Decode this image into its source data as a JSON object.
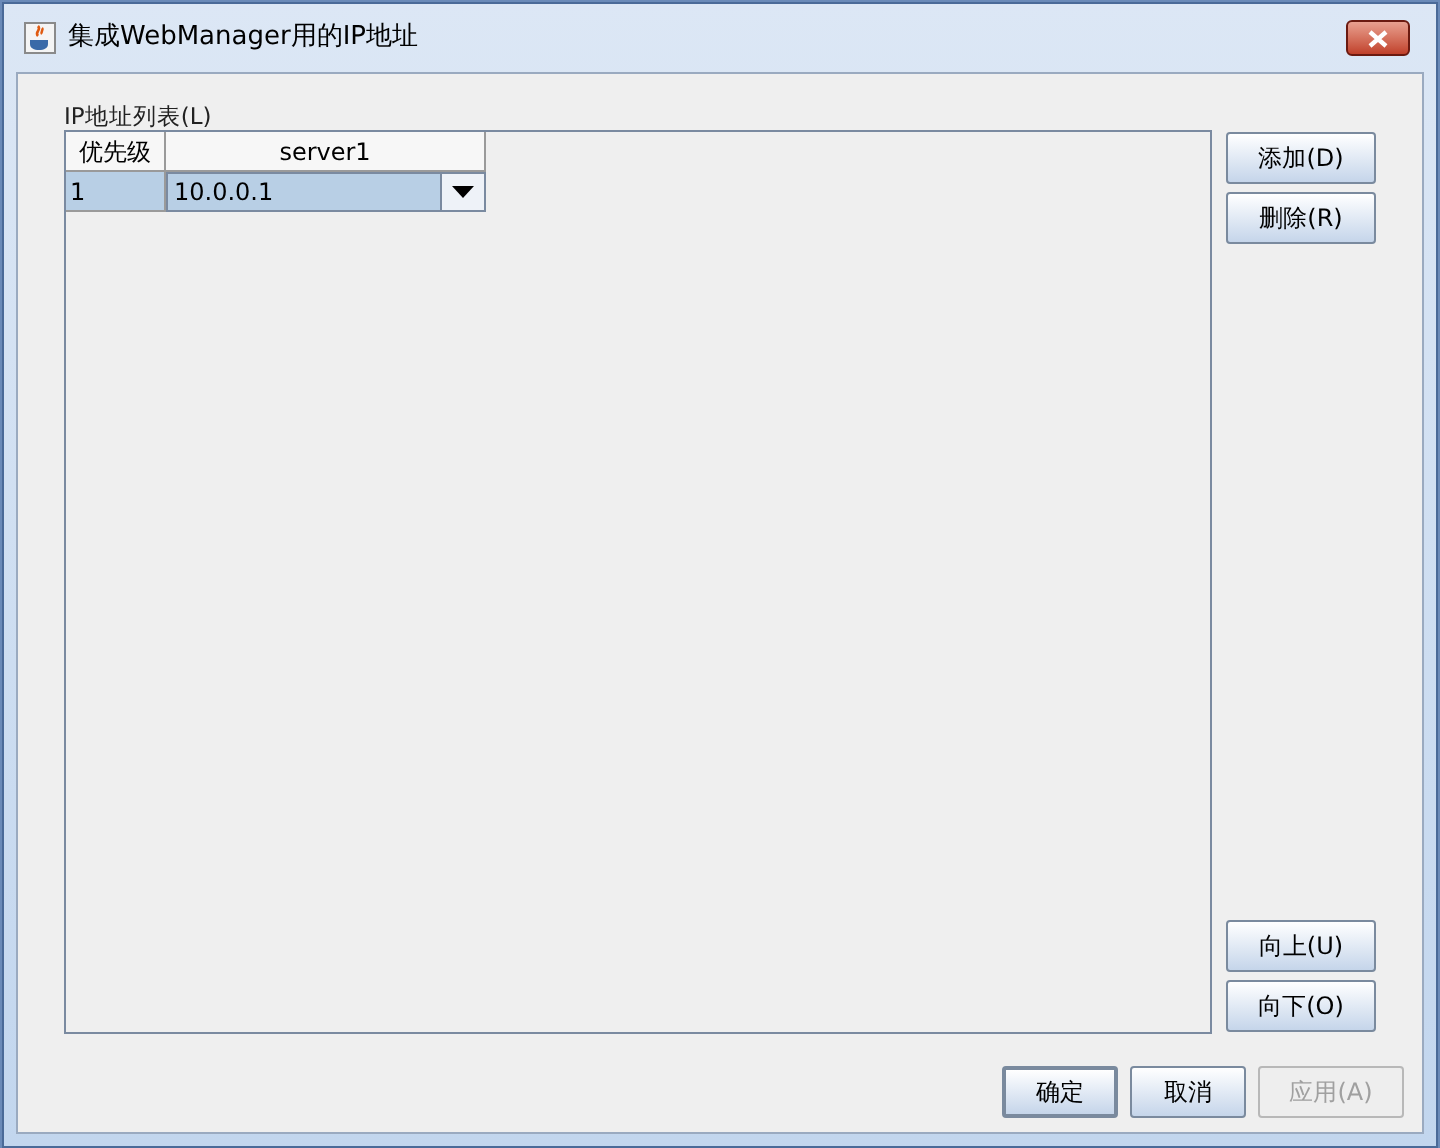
{
  "window": {
    "title": "集成WebManager用的IP地址"
  },
  "list_label": "IP地址列表(L)",
  "table": {
    "columns": [
      "优先级",
      "server1"
    ],
    "rows": [
      {
        "cells": [
          "1",
          "10.0.0.1"
        ],
        "selected": true
      }
    ]
  },
  "side_buttons_top": [
    {
      "label": "添加(D)",
      "disabled": false
    },
    {
      "label": "删除(R)",
      "disabled": false
    }
  ],
  "side_buttons_bottom": [
    {
      "label": "向上(U)",
      "disabled": false
    },
    {
      "label": "向下(O)",
      "disabled": false
    }
  ],
  "footer_buttons": [
    {
      "label": "确定",
      "disabled": false,
      "default": true
    },
    {
      "label": "取消",
      "disabled": false,
      "default": false
    },
    {
      "label": "应用(A)",
      "disabled": true,
      "default": false
    }
  ]
}
